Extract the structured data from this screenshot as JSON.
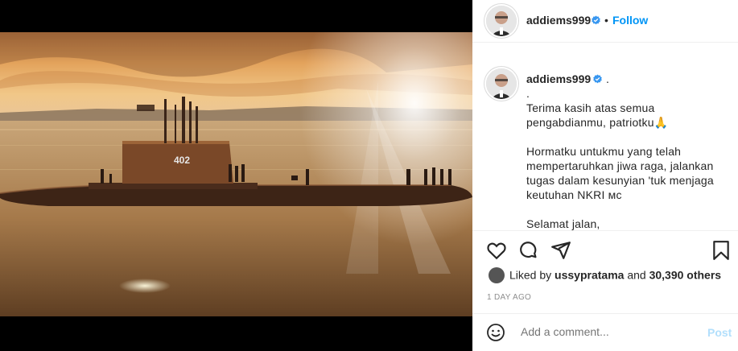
{
  "header": {
    "username": "addiems999",
    "separator": "•",
    "follow_label": "Follow"
  },
  "caption": {
    "username": "addiems999",
    "suffix": ".",
    "paragraphs": [
      ".\nTerima kasih atas semua pengabdianmu, patriotku🙏",
      "Hormatku untukmu yang telah mempertaruhkan jiwa raga, jalankan tugas dalam kesunyian 'tuk menjaga keutuhan NKRI ᴍᴄ",
      "Selamat jalan,"
    ]
  },
  "image": {
    "hull_number": "402"
  },
  "likes": {
    "prefix": "Liked by ",
    "first_liker": "ussypratama",
    "middle": " and ",
    "others": "30,390 others"
  },
  "timestamp": "1 DAY AGO",
  "comment": {
    "placeholder": "Add a comment...",
    "post_label": "Post"
  },
  "colors": {
    "accent": "#0095f6",
    "verified": "#3897f0",
    "post_disabled": "#b2dffc"
  },
  "icons": [
    "heart-icon",
    "comment-icon",
    "share-icon",
    "bookmark-icon",
    "emoji-icon",
    "verified-icon"
  ]
}
